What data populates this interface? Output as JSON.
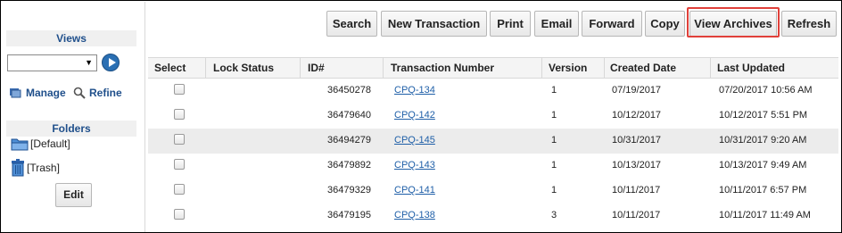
{
  "sidebar": {
    "views_heading": "Views",
    "views_select_value": "",
    "manage_label": "Manage",
    "refine_label": "Refine",
    "folders_heading": "Folders",
    "folders": [
      "[Default]",
      "[Trash]"
    ],
    "edit_label": "Edit"
  },
  "toolbar": {
    "buttons": [
      "Search",
      "New Transaction",
      "Print",
      "Email",
      "Forward",
      "Copy",
      "View Archives",
      "Refresh"
    ]
  },
  "table": {
    "columns": [
      "Select",
      "Lock Status",
      "ID#",
      "Transaction Number",
      "Version",
      "Created Date",
      "Last Updated"
    ],
    "rows": [
      {
        "id": "36450278",
        "txn": "CPQ-134",
        "version": "1",
        "created": "07/19/2017",
        "updated": "07/20/2017 10:56 AM"
      },
      {
        "id": "36479640",
        "txn": "CPQ-142",
        "version": "1",
        "created": "10/12/2017",
        "updated": "10/12/2017 5:51 PM"
      },
      {
        "id": "36494279",
        "txn": "CPQ-145",
        "version": "1",
        "created": "10/31/2017",
        "updated": "10/31/2017 9:20 AM"
      },
      {
        "id": "36479892",
        "txn": "CPQ-143",
        "version": "1",
        "created": "10/13/2017",
        "updated": "10/13/2017 9:49 AM"
      },
      {
        "id": "36479329",
        "txn": "CPQ-141",
        "version": "1",
        "created": "10/11/2017",
        "updated": "10/11/2017 6:57 PM"
      },
      {
        "id": "36479195",
        "txn": "CPQ-138",
        "version": "3",
        "created": "10/11/2017",
        "updated": "10/11/2017 11:49 AM"
      }
    ]
  },
  "colors": {
    "accent_blue": "#1f4f8b",
    "link_blue": "#1f5fa8",
    "highlight_red": "#e0403a"
  }
}
